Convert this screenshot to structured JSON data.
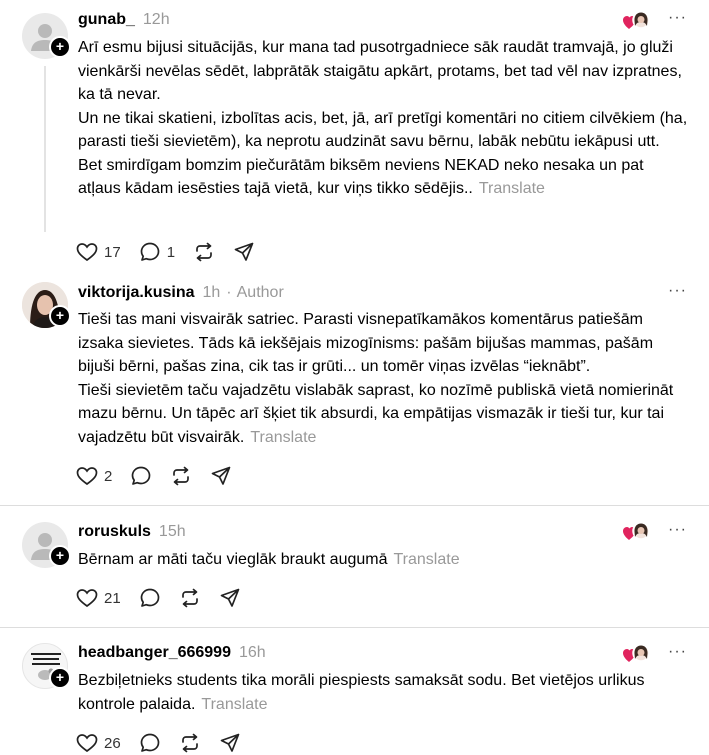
{
  "posts": [
    {
      "username": "gunab_",
      "time": "12h",
      "author_tag": "",
      "body": [
        "Arī esmu bijusi situācijās, kur mana tad pusotrgadniece sāk raudāt tramvajā, jo gluži vienkārši nevēlas sēdēt, labprātāk staigātu apkārt, protams, bet tad vēl nav izpratnes, ka tā nevar.",
        "Un ne tikai skatieni, izbolītas acis, bet, jā, arī pretīgi komentāri no citiem cilvēkiem (ha, parasti tieši sievietēm), ka neprotu audzināt savu bērnu, labāk nebūtu iekāpusi utt.",
        "Bet smirdīgam bomzim piečurātām biksēm neviens NEKAD neko nesaka un pat atļaus kādam iesēsties tajā vietā, kur viņs tikko sēdējis.."
      ],
      "translate": "Translate",
      "likes": "17",
      "replies": "1"
    },
    {
      "username": "viktorija.kusina",
      "time": "1h",
      "author_tag": "Author",
      "body": [
        "Tieši tas mani visvairāk satriec. Parasti visnepatīkamākos komentārus patiešām izsaka sievietes. Tāds kā iekšējais mizogīnisms: pašām bijušas mammas, pašām bijuši bērni, pašas zina, cik tas ir grūti... un tomēr viņas izvēlas “ieknābt”.",
        "Tieši sievietēm taču vajadzētu vislabāk saprast, ko nozīmē publiskā vietā nomierināt mazu bērnu. Un tāpēc arī šķiet tik absurdi, ka empātijas vismazāk ir tieši tur, kur tai vajadzētu būt visvairāk."
      ],
      "translate": "Translate",
      "likes": "2",
      "replies": ""
    },
    {
      "username": "roruskuls",
      "time": "15h",
      "author_tag": "",
      "body": [
        "Bērnam ar māti taču vieglāk braukt augumā"
      ],
      "translate": "Translate",
      "likes": "21",
      "replies": ""
    },
    {
      "username": "headbanger_666999",
      "time": "16h",
      "author_tag": "",
      "body": [
        "Bezbiļetnieks students tika morāli piespiests samaksāt sodu. Bet vietējos urlikus kontrole palaida."
      ],
      "translate": "Translate",
      "likes": "26",
      "replies": ""
    }
  ],
  "more_glyph": "···",
  "avatar_text_headbanger": "CHICKEN GAME · DON'T LOOK AT THIS CHICKEN",
  "colors": {
    "like_heart": "#e0245e",
    "muted": "#999999",
    "divider": "#dddddd"
  }
}
